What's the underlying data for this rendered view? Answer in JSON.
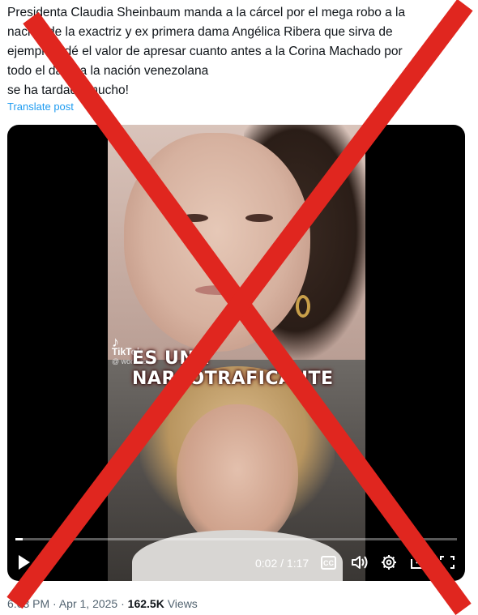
{
  "tweet": {
    "lines": [
      "Presidenta Claudia Sheinbaum manda a la cárcel por el mega robo a la",
      "nación de la exactriz y ex primera dama Angélica Ribera que sirva de",
      "ejemplo y dé el valor de apresar cuanto antes a la Corina Machado por",
      "todo el daño a la nación venezolana",
      "se ha tardado mucho!"
    ],
    "translate_label": "Translate post"
  },
  "video": {
    "caption": "ES UNA NARCOTRAFICANTE",
    "watermark": {
      "brand": "TikTok",
      "user": "@ worldnews"
    },
    "progress": 0.017,
    "time": "0:02 / 1:17",
    "cc_label": "CC",
    "icons": [
      "play-icon",
      "closed-captions-icon",
      "volume-icon",
      "settings-gear-icon",
      "picture-in-picture-icon",
      "fullscreen-icon"
    ]
  },
  "meta": {
    "time": "6:03 PM",
    "separator": "·",
    "date": "Apr 1, 2025",
    "views_count": "162.5K",
    "views_label": "Views"
  },
  "overlay": {
    "color": "#e0261f"
  }
}
